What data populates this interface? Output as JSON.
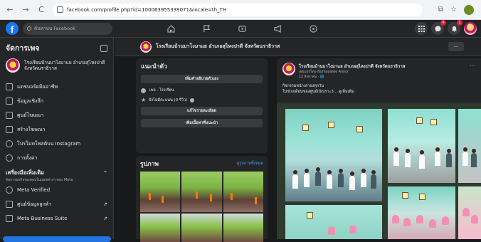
{
  "browser": {
    "url": "facebook.com/profile.php?id=100063955339071&locale=th_TH",
    "nav_back": "←",
    "nav_forward": "→",
    "nav_reload": "C",
    "ext_icon": "⧉",
    "star_icon": "☆"
  },
  "fb_header": {
    "logo": "f",
    "search_placeholder": "ค้นหาบน Facebook",
    "center_icons": [
      "home-icon",
      "flag-icon",
      "video-icon",
      "megaphone-icon",
      "game-icon"
    ],
    "right_icons": [
      "menu-grid-icon",
      "messenger-icon",
      "bell-icon"
    ],
    "messenger_badge": "4",
    "bell_badge": "1"
  },
  "sidebar": {
    "title": "จัดการเพจ",
    "page_name": "โรงเรียนบ้านบาโงมาแย อำเภอสุไหงปาดี จังหวัดนราธิวาส",
    "items": [
      {
        "label": "แดชบอร์ดมืออาชีพ",
        "icon": "dashboard-icon"
      },
      {
        "label": "ข้อมูลเชิงลึก",
        "icon": "insights-icon"
      },
      {
        "label": "ศูนย์โฆษณา",
        "icon": "ad-center-icon"
      },
      {
        "label": "สร้างโฆษณา",
        "icon": "create-ad-icon"
      },
      {
        "label": "โปรโมทโพสต์บน Instagram",
        "icon": "instagram-icon"
      },
      {
        "label": "การตั้งค่า",
        "icon": "settings-icon"
      }
    ],
    "tools_title": "เครื่องมือเพิ่มเติม",
    "tools_sub": "จัดการธุรกิจของคุณในแอพต่างๆ ของ Meta",
    "tools": [
      {
        "label": "Meta Verified",
        "icon": "verified-icon"
      },
      {
        "label": "ศูนย์ข้อมูลลูกค้า",
        "icon": "customer-icon"
      },
      {
        "label": "Meta Business Suite",
        "icon": "business-suite-icon"
      }
    ]
  },
  "pagebar": {
    "name": "โรงเรียนบ้านบาโงมาแย อำเภอสุไหงปาดี จังหวัดนราธิวาส",
    "more": "···"
  },
  "intro": {
    "title": "แนะนำตัว",
    "add_bio": "เพิ่มคำอธิบายตัวเอง",
    "category": "เพจ · โรงเรียน",
    "rating": "ยังไม่มีคะแนน (0 รีวิว)",
    "edit_details": "แก้ไขรายละเอียด",
    "add_featured": "เพิ่มเนื้อหาที่แนะนำ"
  },
  "photos": {
    "title": "รูปภาพ",
    "see_all": "ดูรูปภาพทั้งหมด"
  },
  "post": {
    "author": "โรงเรียนบ้านบาโงมาแย อำเภอสุไหงปาดี จังหวัดนราธิวาส",
    "posted_by": "เผยแพร่โดย Nurhayatee Annur",
    "date": "12 สิงหาคม · 🌐",
    "text1": "กิจกรรมหน้าเสาธงทุกวัน",
    "text2": "ในช่วงเดือนของศูนย์เบ้เบราะ3... ดูเพิ่มเติม",
    "more": "···"
  }
}
